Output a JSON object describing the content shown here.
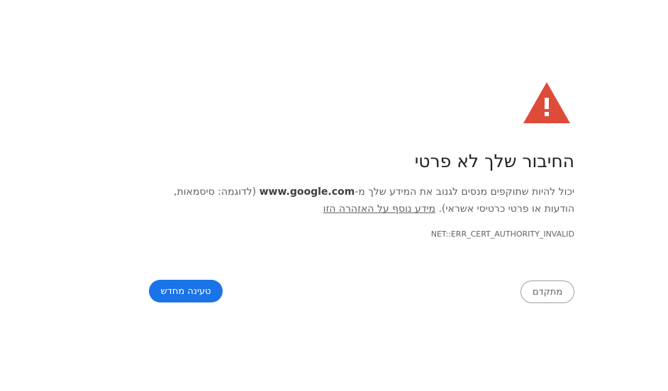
{
  "error": {
    "title": "החיבור שלך לא פרטי",
    "message_part1": "יכול להיות שתוקפים מנסים לגנוב את המידע שלך מ-",
    "domain": "www.google.com",
    "message_part2": " (לדוגמה: סיסמאות, הודעות או פרטי כרטיסי אשראי). ",
    "learn_more": "מידע נוסף על האזהרה הזו",
    "code": "NET::ERR_CERT_AUTHORITY_INVALID"
  },
  "buttons": {
    "reload": "טעינה מחדש",
    "advanced": "מתקדם"
  },
  "icons": {
    "warning": "warning-triangle-icon"
  },
  "colors": {
    "warning_red": "#dd4b39",
    "primary_blue": "#1a73e8"
  }
}
